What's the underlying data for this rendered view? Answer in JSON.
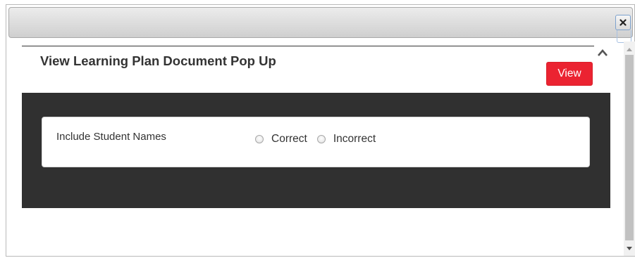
{
  "dialog": {
    "close_icon": "close-icon",
    "heading": "View Learning Plan Document Pop Up",
    "collapse_icon": "chevron-up-icon",
    "view_button_label": "View",
    "accent_color": "#eb2331",
    "panel_color": "#303030"
  },
  "options": {
    "label": "Include Student Names",
    "choices": [
      {
        "label": "Correct",
        "selected": false
      },
      {
        "label": "Incorrect",
        "selected": false
      }
    ]
  },
  "scrollbar": {
    "up_icon": "arrow-up-icon",
    "down_icon": "arrow-down-icon"
  }
}
